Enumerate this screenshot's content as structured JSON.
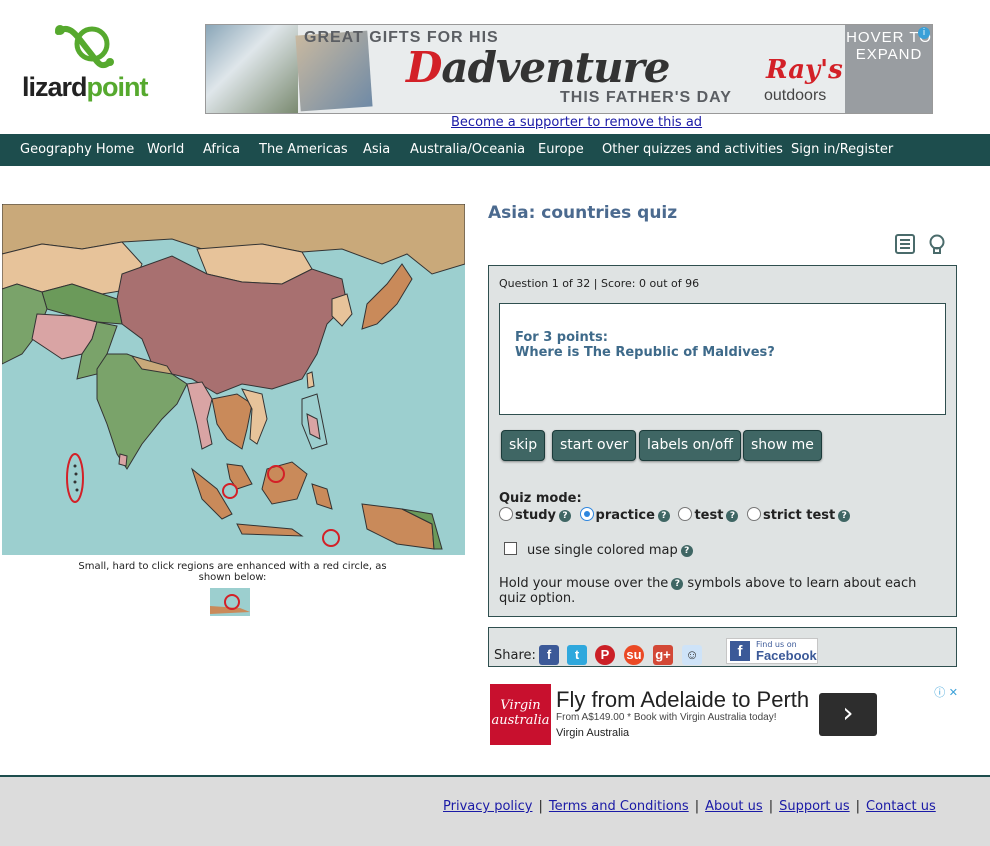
{
  "logo": {
    "text_part1": "lizard",
    "text_part2": "point"
  },
  "banner_ad": {
    "line1": "GREAT GIFTS FOR HIS",
    "headline_d": "D",
    "headline_rest": "adventure",
    "line3": "THIS FATHER'S DAY",
    "brand": "Ray's",
    "brand_sub": "outdoors",
    "hover_line1": "HOVER TO",
    "hover_line2": "EXPAND"
  },
  "supporter_link": "Become a supporter to remove this ad",
  "nav": {
    "items": [
      "Geography Home",
      "World",
      "Africa",
      "The Americas",
      "Asia",
      "Australia/Oceania",
      "Europe",
      "Other quizzes and activities",
      "Sign in/Register"
    ]
  },
  "map": {
    "caption": "Small, hard to click regions are enhanced with a red circle, as shown below:",
    "water_color": "#9ccfcf",
    "highlight_color": "#d32027"
  },
  "quiz": {
    "title": "Asia: countries quiz",
    "status": "Question 1 of 32 | Score: 0 out of 96",
    "question_points": "For 3 points:",
    "question_text": "Where is The Republic of Maldives?",
    "buttons": [
      "skip",
      "start over",
      "labels on/off",
      "show me"
    ],
    "mode_label": "Quiz mode:",
    "modes": [
      {
        "label": "study",
        "selected": false
      },
      {
        "label": "practice",
        "selected": true
      },
      {
        "label": "test",
        "selected": false
      },
      {
        "label": "strict test",
        "selected": false
      }
    ],
    "single_color_label": "use single colored map",
    "single_color_checked": false,
    "hold_text_1": "Hold your mouse over the",
    "hold_text_2": "symbols above to learn about each quiz option.",
    "help_symbol": "?"
  },
  "share": {
    "label": "Share:",
    "networks": [
      "facebook",
      "twitter",
      "pinterest",
      "stumbleupon",
      "google-plus",
      "reddit"
    ],
    "fb_badge_line1": "Find us on",
    "fb_badge_line2": "Facebook"
  },
  "bottom_ad": {
    "logo_text": "Virgin australia",
    "headline": "Fly from Adelaide to Perth",
    "sub": "From A$149.00 *  Book with Virgin Australia today!",
    "brand": "Virgin Australia",
    "arrow": "›"
  },
  "footer": {
    "links": [
      "Privacy policy",
      "Terms and Conditions",
      "About us",
      "Support us",
      "Contact us"
    ]
  }
}
